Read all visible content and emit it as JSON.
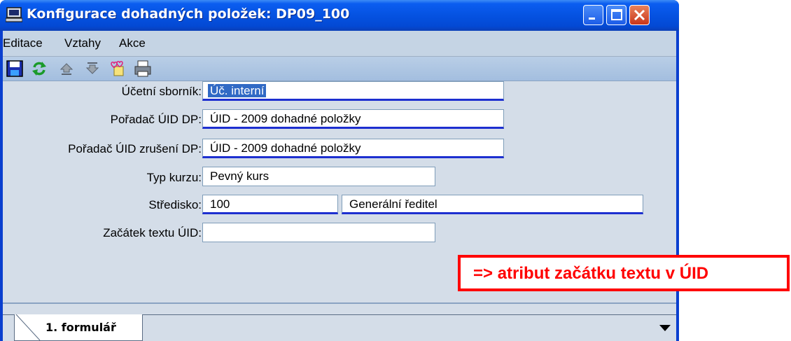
{
  "window": {
    "title": "Konfigurace dohadných položek: DP09_100",
    "controls": {
      "minimize": "minimize-icon",
      "maximize": "maximize-icon",
      "close": "close-icon"
    }
  },
  "menu": {
    "items": [
      "Editace",
      "Vztahy",
      "Akce"
    ]
  },
  "toolbar": {
    "icons": [
      "save-icon",
      "refresh-icon",
      "move-up-icon",
      "move-down-icon",
      "hearts-icon",
      "print-icon"
    ]
  },
  "form": {
    "ucetni_sbornik": {
      "label": "Účetní sborník:",
      "value": "Úč. interní"
    },
    "poradac_uid_dp": {
      "label": "Pořadač ÚID DP:",
      "value": "ÚID - 2009 dohadné položky"
    },
    "poradac_uid_zruseni": {
      "label": "Pořadač ÚID zrušení DP:",
      "value": "ÚID - 2009 dohadné položky"
    },
    "typ_kurzu": {
      "label": "Typ kurzu:",
      "value": "Pevný kurs"
    },
    "stredisko": {
      "label": "Středisko:",
      "code": "100",
      "name": "Generální ředitel"
    },
    "zacatek_textu": {
      "label": "Začátek textu ÚID:",
      "value": ""
    }
  },
  "tabs": {
    "items": [
      "1. formulář"
    ]
  },
  "annotation": {
    "text": "=> atribut začátku textu v ÚID"
  },
  "colors": {
    "title_bar": "#0552e1",
    "client_bg": "#d4dde8",
    "required_underline": "#1d2fd0",
    "selection": "#316ac5",
    "annotation": "#ff0000"
  }
}
